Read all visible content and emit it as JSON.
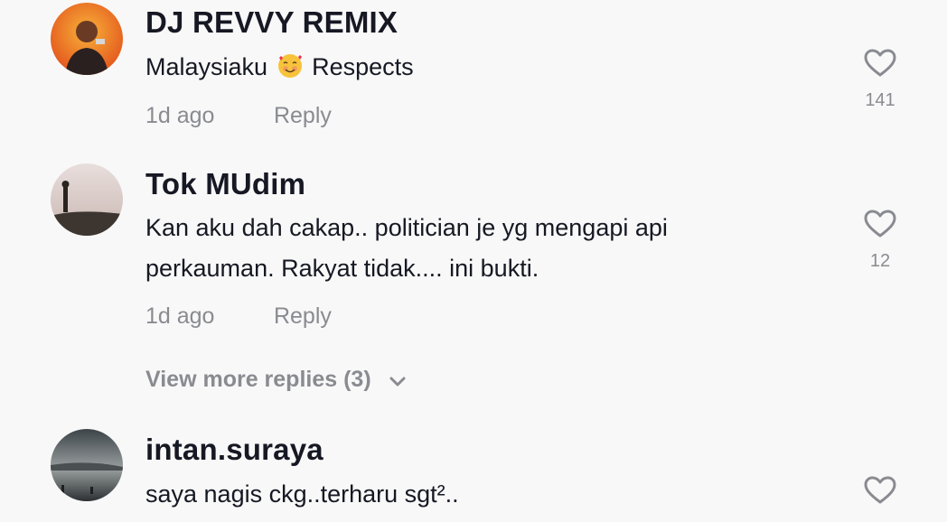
{
  "comments": [
    {
      "username": "DJ REVVY REMIX",
      "text_before": "Malaysiaku",
      "emoji": "smiling-face-with-hearts",
      "text_after": "Respects",
      "time": "1d ago",
      "reply_label": "Reply",
      "likes": "141"
    },
    {
      "username": "Tok MUdim",
      "text_line1": "Kan aku dah cakap.. politician je yg mengapi api",
      "text_line2": "perkauman. Rakyat tidak.... ini bukti.",
      "time": "1d ago",
      "reply_label": "Reply",
      "likes": "12"
    },
    {
      "username": "intan.suraya",
      "text": "saya nagis ckg..terharu sgt².."
    }
  ],
  "view_more_replies": "View more replies (3)",
  "icons": {
    "like": "heart-outline-icon",
    "expand": "chevron-down-icon"
  },
  "colors": {
    "background": "#f8f8f8",
    "primary_text": "#161823",
    "secondary_text": "#8a8b91"
  }
}
